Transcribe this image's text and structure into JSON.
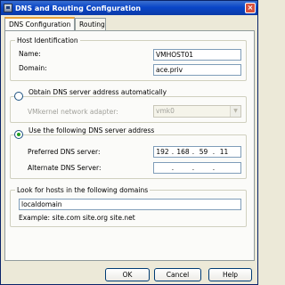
{
  "window": {
    "title": "DNS and Routing Configuration",
    "close_glyph": "×"
  },
  "tabs": [
    {
      "label": "DNS Configuration",
      "active": true
    },
    {
      "label": "Routing",
      "active": false
    }
  ],
  "host_identification": {
    "title": "Host Identification",
    "name_label": "Name:",
    "name_value": "VMHOST01",
    "domain_label": "Domain:",
    "domain_value": "ace.priv"
  },
  "dns_auto": {
    "radio_label": "Obtain DNS server address automatically",
    "selected": false,
    "adapter_label": "VMkernel network adapter:",
    "adapter_value": "vmk0",
    "dropdown_glyph": "▼"
  },
  "dns_manual": {
    "radio_label": "Use the following DNS server address",
    "selected": true,
    "preferred_label": "Preferred DNS server:",
    "preferred_octets": [
      "192",
      "168",
      "59",
      "11"
    ],
    "alternate_label": "Alternate DNS Server:",
    "alternate_octets": [
      "",
      "",
      "",
      ""
    ],
    "separator": "."
  },
  "search_domains": {
    "title": "Look for hosts in the following domains",
    "value": "localdomain",
    "example": "Example: site.com site.org site.net"
  },
  "buttons": {
    "ok": "OK",
    "cancel": "Cancel",
    "help": "Help"
  }
}
